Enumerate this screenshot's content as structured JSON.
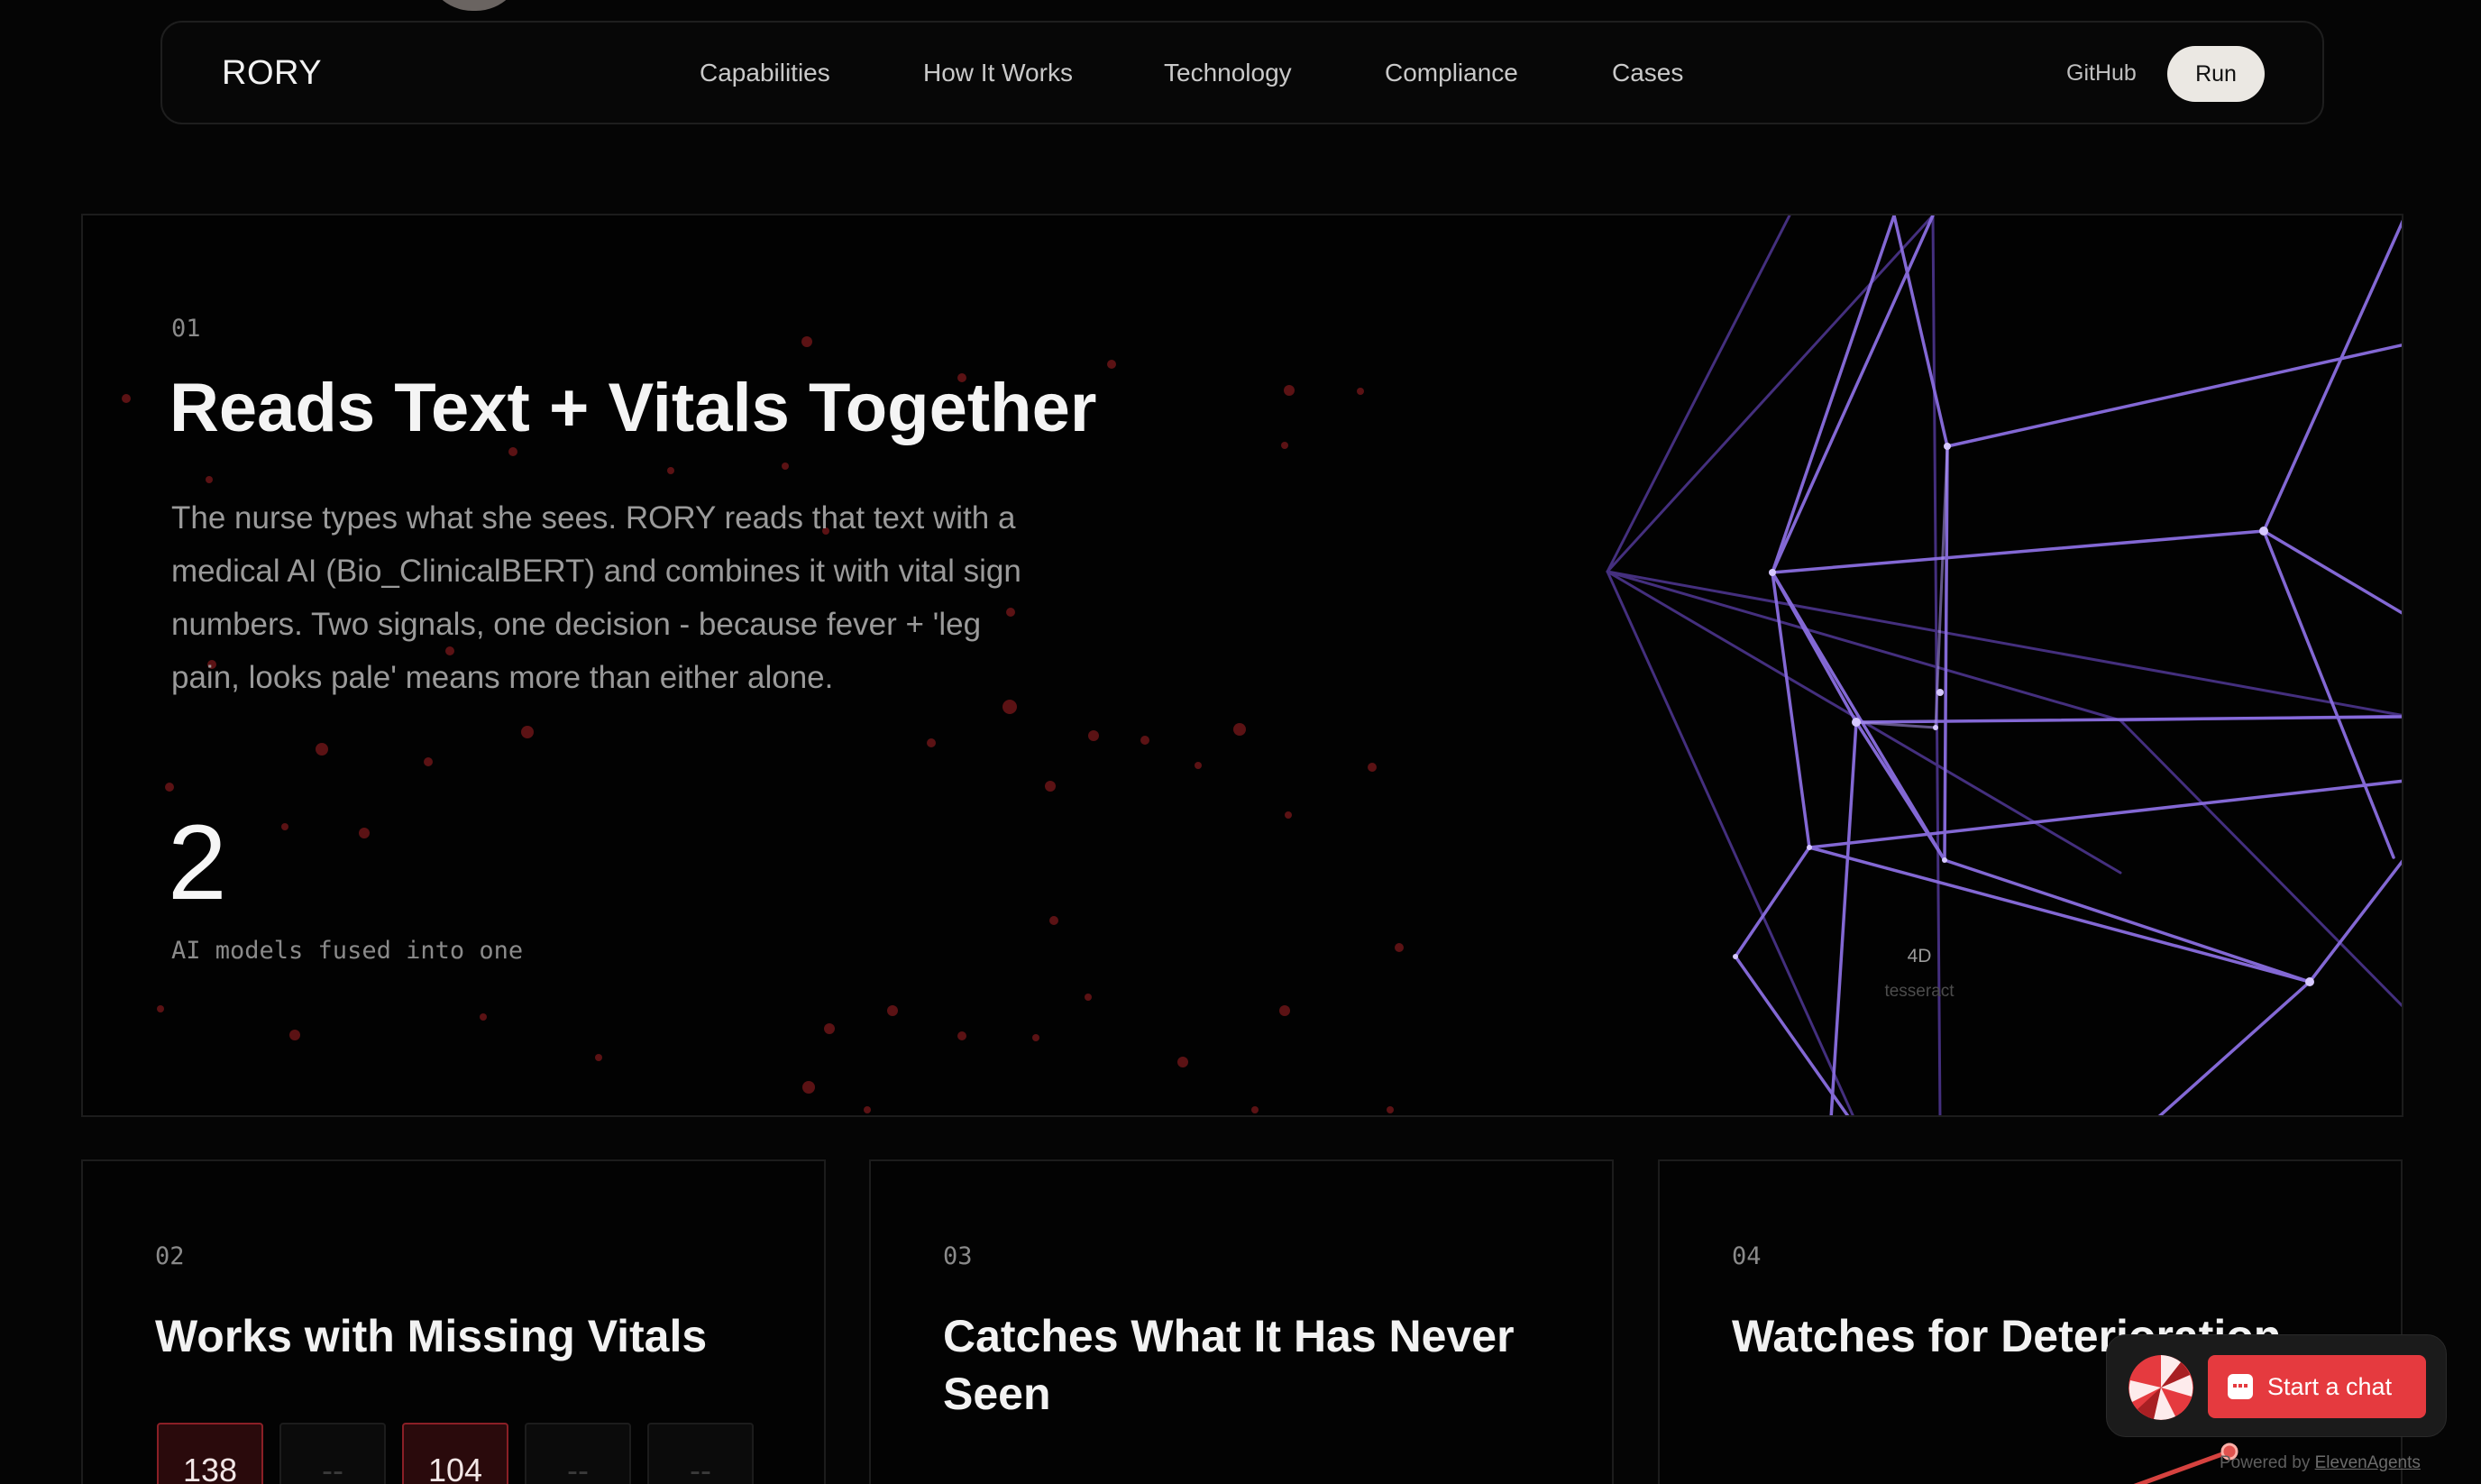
{
  "nav": {
    "brand": "RORY",
    "links": [
      "Capabilities",
      "How It Works",
      "Technology",
      "Compliance",
      "Cases"
    ],
    "github": "GitHub",
    "run": "Run"
  },
  "hero": {
    "number": "01",
    "title": "Reads Text + Vitals Together",
    "description": "The nurse types what she sees. RORY reads that text with a medical AI (Bio_ClinicalBERT) and combines it with vital sign numbers. Two signals, one decision - because fever + 'leg pain, looks pale' means more than either alone.",
    "stat_value": "2",
    "stat_label": "AI models fused into one",
    "tesseract_label": "4D",
    "tesseract_sublabel": "tesseract"
  },
  "cards": [
    {
      "number": "02",
      "title": "Works with Missing Vitals",
      "vitals": [
        "138",
        "--",
        "104",
        "--",
        "--"
      ]
    },
    {
      "number": "03",
      "title": "Catches What It Has Never Seen"
    },
    {
      "number": "04",
      "title": "Watches for Deterioration"
    }
  ],
  "chat_widget": {
    "button_label": "Start a chat",
    "powered_prefix": "Powered by",
    "powered_link": "ElevenAgents"
  },
  "colors": {
    "background": "#050505",
    "accent_red": "#e53a3f",
    "tesseract_purple": "#8a6ee0"
  }
}
